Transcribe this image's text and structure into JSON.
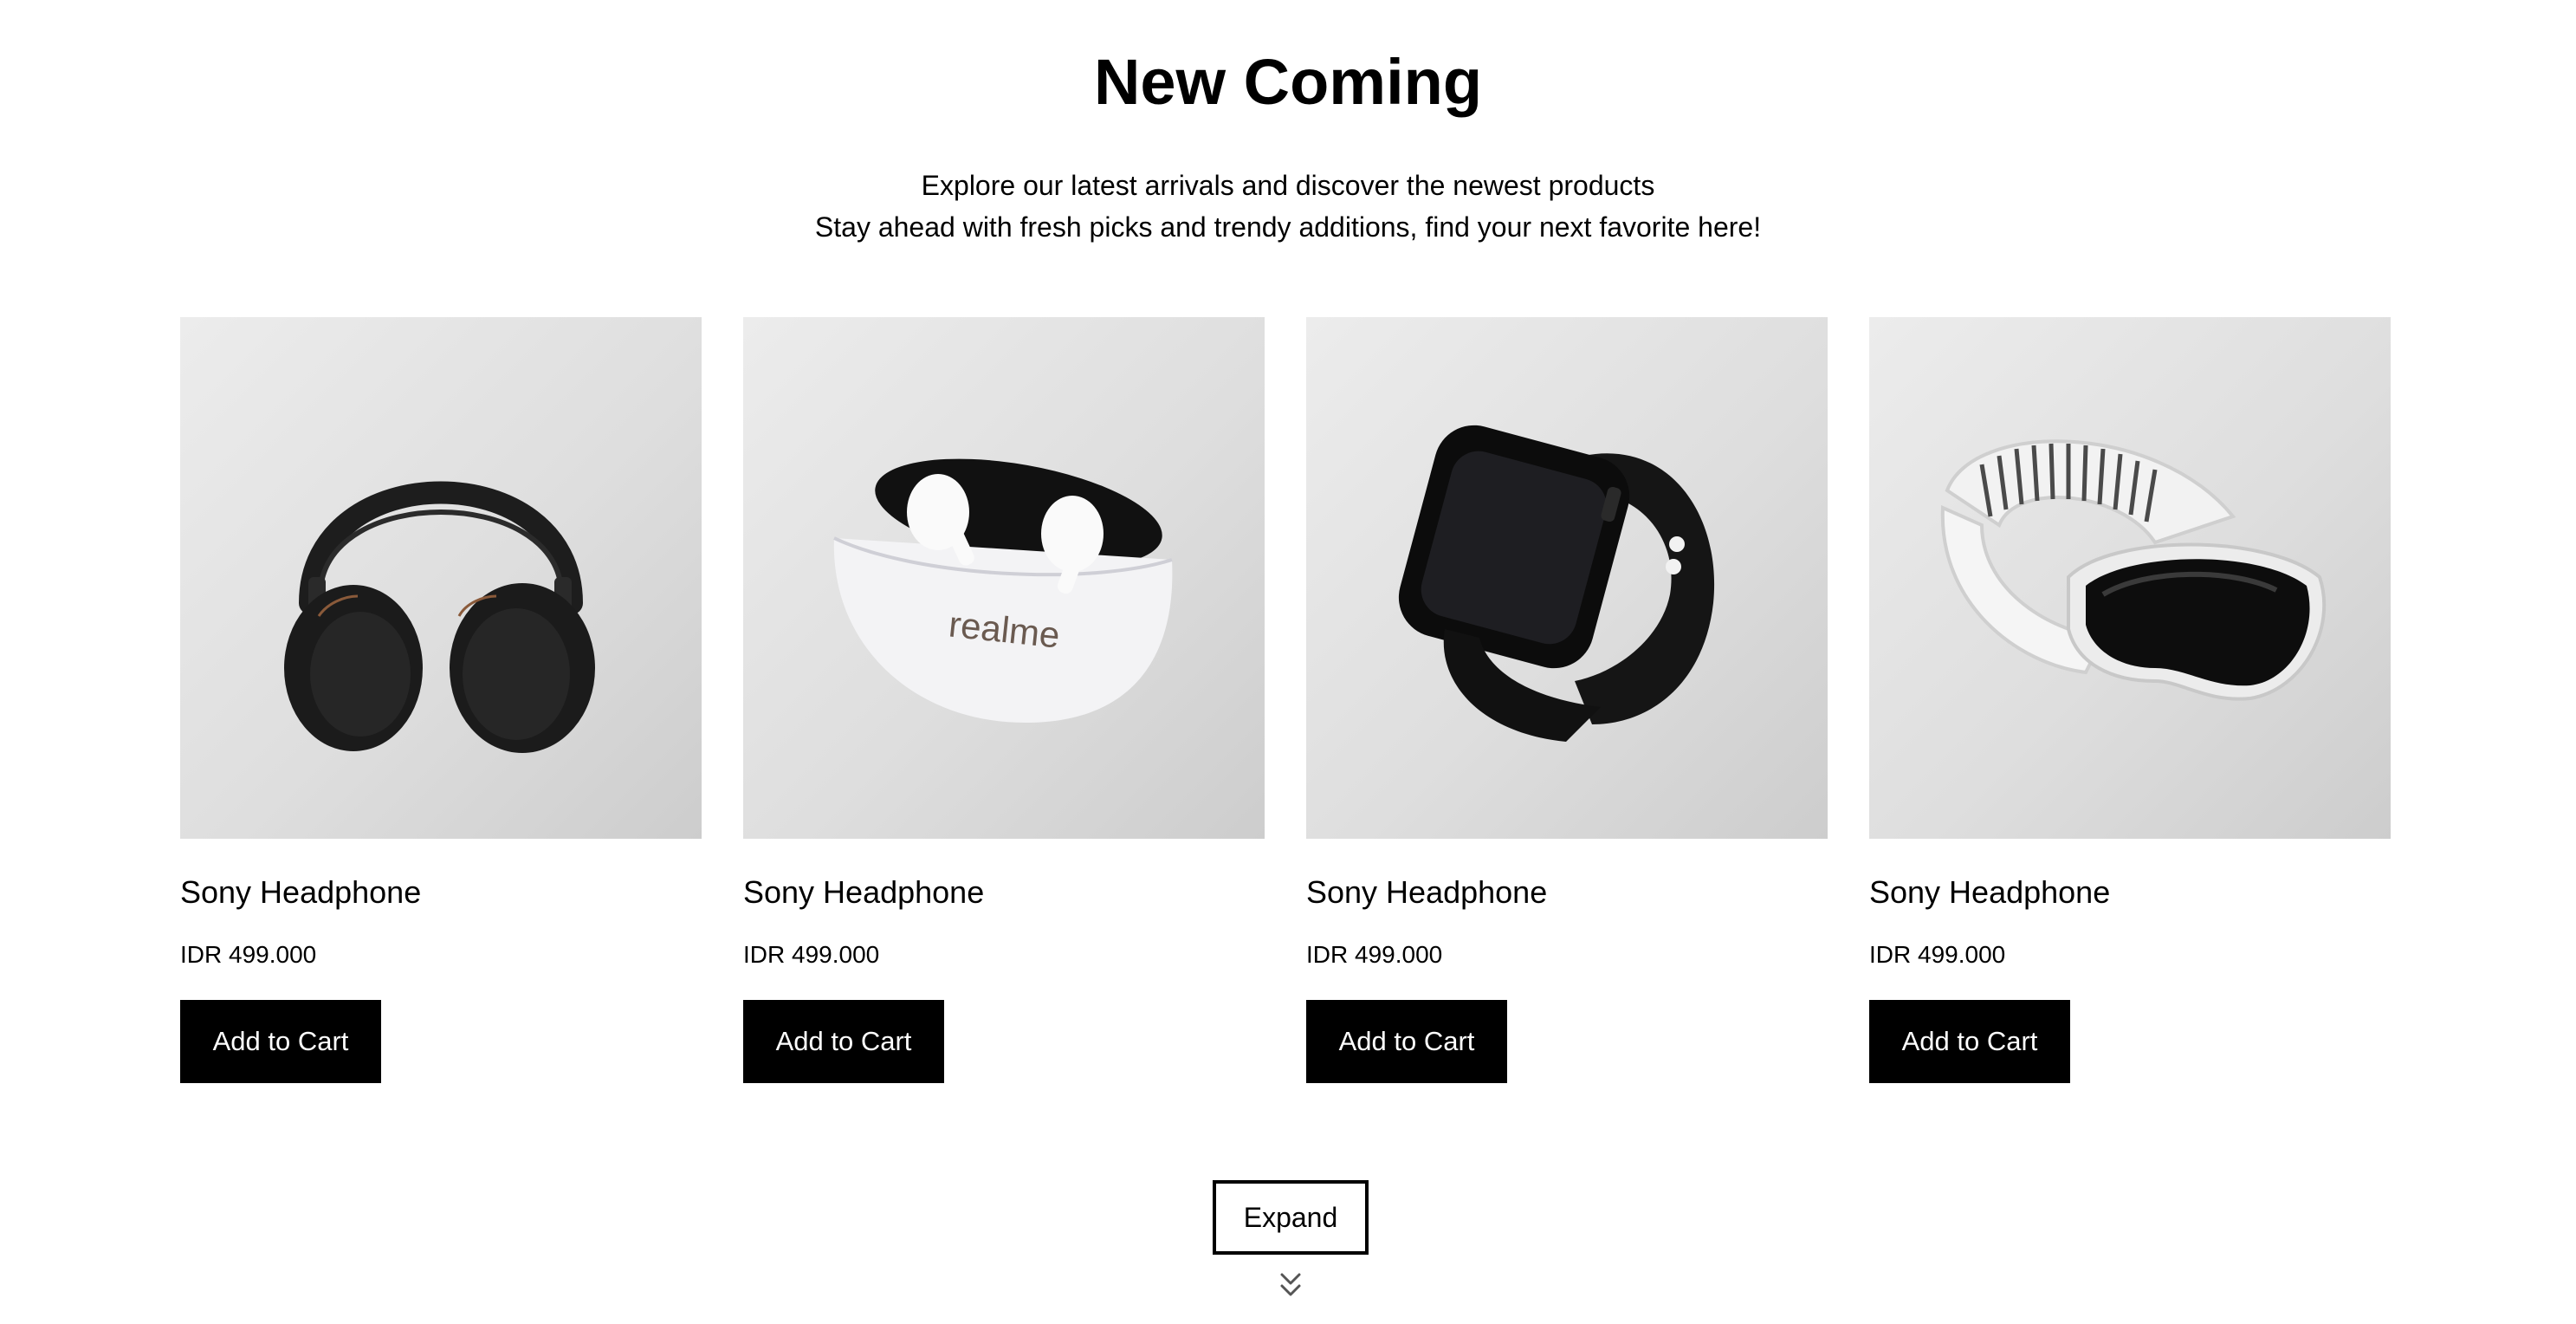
{
  "section": {
    "title": "New Coming",
    "subtitle_line1": "Explore our latest arrivals and discover the newest products",
    "subtitle_line2": "Stay ahead with fresh picks and trendy additions, find your next favorite here!"
  },
  "products": [
    {
      "image": "headphone",
      "name": "Sony Headphone",
      "price": "IDR 499.000",
      "cta": "Add to Cart"
    },
    {
      "image": "earbuds",
      "brand_mark": "realme",
      "name": "Sony Headphone",
      "price": "IDR 499.000",
      "cta": "Add to Cart"
    },
    {
      "image": "smartwatch",
      "name": "Sony Headphone",
      "price": "IDR 499.000",
      "cta": "Add to Cart"
    },
    {
      "image": "vr-headset",
      "name": "Sony Headphone",
      "price": "IDR 499.000",
      "cta": "Add to Cart"
    }
  ],
  "expand": {
    "label": "Expand",
    "icon": "double-chevron-down-icon"
  },
  "colors": {
    "background": "#ffffff",
    "text": "#000000",
    "button": "#000000",
    "button_text": "#ffffff",
    "image_bg": "#e2e2e2"
  }
}
